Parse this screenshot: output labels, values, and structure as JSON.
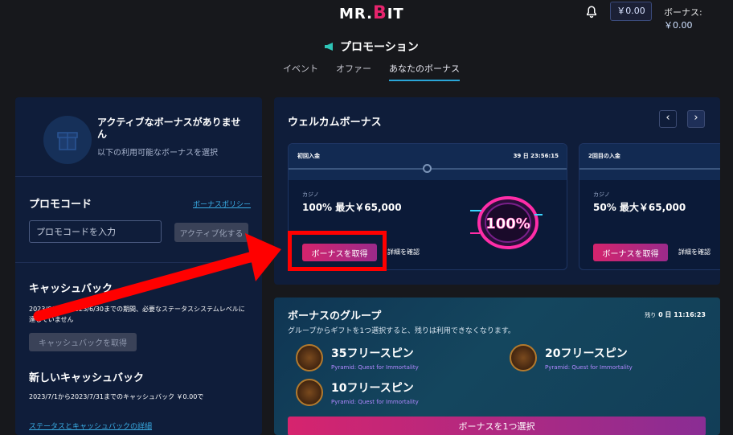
{
  "header": {
    "logo_left": "MR.",
    "logo_b": "B",
    "logo_right": "IT",
    "wallet": "￥0.00",
    "bonus_label": "ボーナス:",
    "bonus_value": "￥0.00"
  },
  "page": {
    "title": "プロモーション",
    "tabs": [
      {
        "label": "イベント",
        "active": false
      },
      {
        "label": "オファー",
        "active": false
      },
      {
        "label": "あなたのボーナス",
        "active": true
      }
    ]
  },
  "left": {
    "no_bonus_title": "アクティブなボーナスがありません",
    "no_bonus_sub": "以下の利用可能なボーナスを選択",
    "promo_title": "プロモコード",
    "policy_link": "ボーナスポリシー",
    "promo_placeholder": "プロモコードを入力",
    "activate_label": "アクティブ化する",
    "cashback_title": "キャッシュバック",
    "cashback_text": "2023/6/1から2023/6/30までの期間、必要なステータスシステムレベルに達していません",
    "cashback_btn": "キャッシュバックを取得",
    "new_cashback_title": "新しいキャッシュバック",
    "new_cashback_text": "2023/7/1から2023/7/31までのキャッシュバック ￥0.00で",
    "status_link": "ステータスとキャッシュバックの詳細"
  },
  "welcome": {
    "title": "ウェルカムボーナス",
    "prev": "‹",
    "next": "›",
    "cards": [
      {
        "label": "初回入金",
        "timer": "39 日 23:56:15",
        "category": "カジノ",
        "offer": "100% 最大￥65,000",
        "claim": "ボーナスを取得",
        "details": "詳細を確認",
        "badge": "100%"
      },
      {
        "label": "2回目の入金",
        "timer": "",
        "category": "カジノ",
        "offer": "50% 最大￥65,000",
        "claim": "ボーナスを取得",
        "details": "詳細を確認"
      }
    ]
  },
  "group": {
    "title": "ボーナスのグループ",
    "subtitle": "グループからギフトを1つ選択すると、残りは利用できなくなります。",
    "remaining_label": "残り",
    "remaining_value": "0 日 11:16:23",
    "spins": [
      {
        "title": "35フリースピン",
        "game": "Pyramid: Quest for Immortality"
      },
      {
        "title": "20フリースピン",
        "game": "Pyramid: Quest for Immortality"
      },
      {
        "title": "10フリースピン",
        "game": "Pyramid: Quest for Immortality"
      }
    ],
    "select_btn": "ボーナスを1つ選択"
  },
  "colors": {
    "accent_pink": "#e6246d",
    "link_blue": "#3aaee6",
    "annotation_red": "#ff0000"
  },
  "icons": [
    "bell-icon",
    "megaphone-icon",
    "gift-icon",
    "chevron-left-icon",
    "chevron-right-icon",
    "pyramid-game-icon"
  ]
}
